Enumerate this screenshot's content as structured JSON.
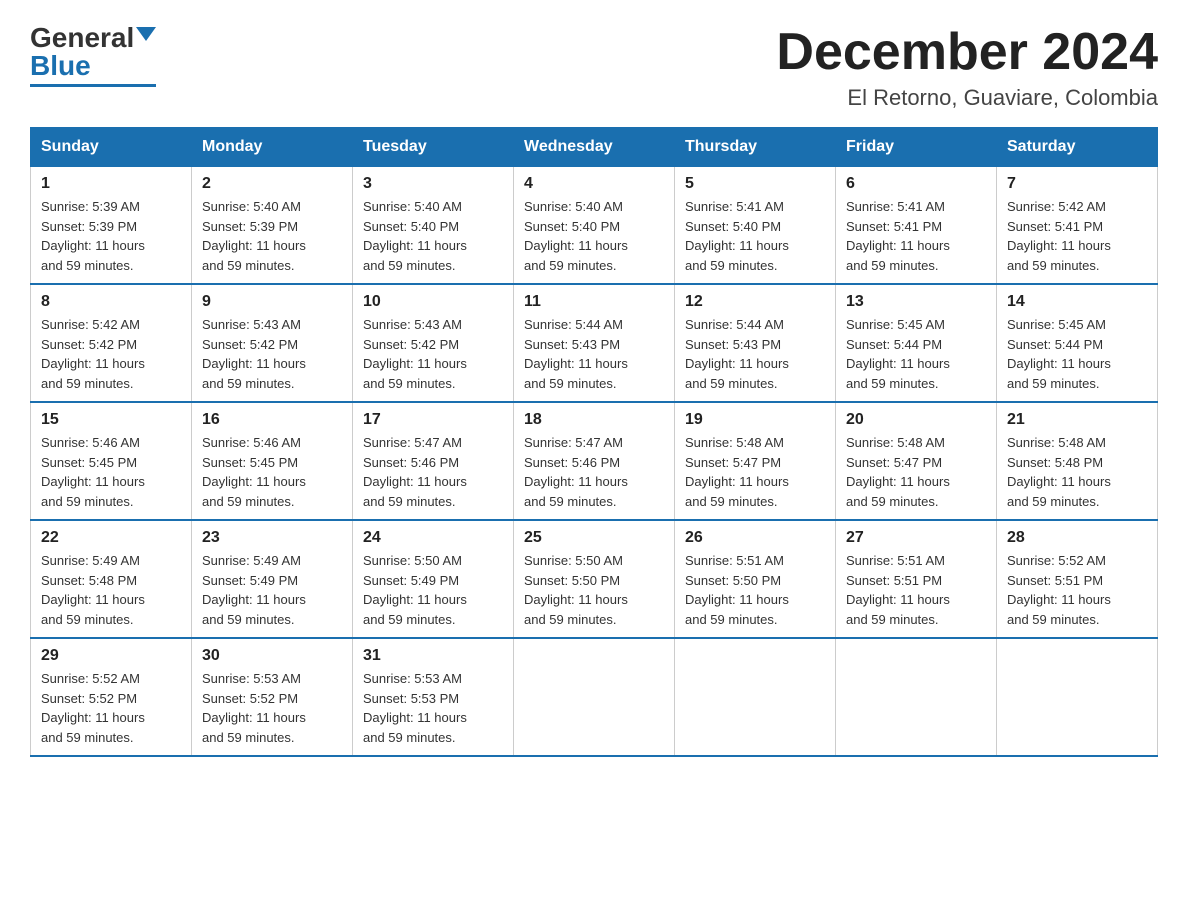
{
  "logo": {
    "general": "General",
    "blue": "Blue"
  },
  "header": {
    "month_title": "December 2024",
    "location": "El Retorno, Guaviare, Colombia"
  },
  "days_of_week": [
    "Sunday",
    "Monday",
    "Tuesday",
    "Wednesday",
    "Thursday",
    "Friday",
    "Saturday"
  ],
  "weeks": [
    [
      {
        "day": "1",
        "sunrise": "5:39 AM",
        "sunset": "5:39 PM",
        "daylight": "11 hours and 59 minutes."
      },
      {
        "day": "2",
        "sunrise": "5:40 AM",
        "sunset": "5:39 PM",
        "daylight": "11 hours and 59 minutes."
      },
      {
        "day": "3",
        "sunrise": "5:40 AM",
        "sunset": "5:40 PM",
        "daylight": "11 hours and 59 minutes."
      },
      {
        "day": "4",
        "sunrise": "5:40 AM",
        "sunset": "5:40 PM",
        "daylight": "11 hours and 59 minutes."
      },
      {
        "day": "5",
        "sunrise": "5:41 AM",
        "sunset": "5:40 PM",
        "daylight": "11 hours and 59 minutes."
      },
      {
        "day": "6",
        "sunrise": "5:41 AM",
        "sunset": "5:41 PM",
        "daylight": "11 hours and 59 minutes."
      },
      {
        "day": "7",
        "sunrise": "5:42 AM",
        "sunset": "5:41 PM",
        "daylight": "11 hours and 59 minutes."
      }
    ],
    [
      {
        "day": "8",
        "sunrise": "5:42 AM",
        "sunset": "5:42 PM",
        "daylight": "11 hours and 59 minutes."
      },
      {
        "day": "9",
        "sunrise": "5:43 AM",
        "sunset": "5:42 PM",
        "daylight": "11 hours and 59 minutes."
      },
      {
        "day": "10",
        "sunrise": "5:43 AM",
        "sunset": "5:42 PM",
        "daylight": "11 hours and 59 minutes."
      },
      {
        "day": "11",
        "sunrise": "5:44 AM",
        "sunset": "5:43 PM",
        "daylight": "11 hours and 59 minutes."
      },
      {
        "day": "12",
        "sunrise": "5:44 AM",
        "sunset": "5:43 PM",
        "daylight": "11 hours and 59 minutes."
      },
      {
        "day": "13",
        "sunrise": "5:45 AM",
        "sunset": "5:44 PM",
        "daylight": "11 hours and 59 minutes."
      },
      {
        "day": "14",
        "sunrise": "5:45 AM",
        "sunset": "5:44 PM",
        "daylight": "11 hours and 59 minutes."
      }
    ],
    [
      {
        "day": "15",
        "sunrise": "5:46 AM",
        "sunset": "5:45 PM",
        "daylight": "11 hours and 59 minutes."
      },
      {
        "day": "16",
        "sunrise": "5:46 AM",
        "sunset": "5:45 PM",
        "daylight": "11 hours and 59 minutes."
      },
      {
        "day": "17",
        "sunrise": "5:47 AM",
        "sunset": "5:46 PM",
        "daylight": "11 hours and 59 minutes."
      },
      {
        "day": "18",
        "sunrise": "5:47 AM",
        "sunset": "5:46 PM",
        "daylight": "11 hours and 59 minutes."
      },
      {
        "day": "19",
        "sunrise": "5:48 AM",
        "sunset": "5:47 PM",
        "daylight": "11 hours and 59 minutes."
      },
      {
        "day": "20",
        "sunrise": "5:48 AM",
        "sunset": "5:47 PM",
        "daylight": "11 hours and 59 minutes."
      },
      {
        "day": "21",
        "sunrise": "5:48 AM",
        "sunset": "5:48 PM",
        "daylight": "11 hours and 59 minutes."
      }
    ],
    [
      {
        "day": "22",
        "sunrise": "5:49 AM",
        "sunset": "5:48 PM",
        "daylight": "11 hours and 59 minutes."
      },
      {
        "day": "23",
        "sunrise": "5:49 AM",
        "sunset": "5:49 PM",
        "daylight": "11 hours and 59 minutes."
      },
      {
        "day": "24",
        "sunrise": "5:50 AM",
        "sunset": "5:49 PM",
        "daylight": "11 hours and 59 minutes."
      },
      {
        "day": "25",
        "sunrise": "5:50 AM",
        "sunset": "5:50 PM",
        "daylight": "11 hours and 59 minutes."
      },
      {
        "day": "26",
        "sunrise": "5:51 AM",
        "sunset": "5:50 PM",
        "daylight": "11 hours and 59 minutes."
      },
      {
        "day": "27",
        "sunrise": "5:51 AM",
        "sunset": "5:51 PM",
        "daylight": "11 hours and 59 minutes."
      },
      {
        "day": "28",
        "sunrise": "5:52 AM",
        "sunset": "5:51 PM",
        "daylight": "11 hours and 59 minutes."
      }
    ],
    [
      {
        "day": "29",
        "sunrise": "5:52 AM",
        "sunset": "5:52 PM",
        "daylight": "11 hours and 59 minutes."
      },
      {
        "day": "30",
        "sunrise": "5:53 AM",
        "sunset": "5:52 PM",
        "daylight": "11 hours and 59 minutes."
      },
      {
        "day": "31",
        "sunrise": "5:53 AM",
        "sunset": "5:53 PM",
        "daylight": "11 hours and 59 minutes."
      },
      null,
      null,
      null,
      null
    ]
  ],
  "labels": {
    "sunrise": "Sunrise:",
    "sunset": "Sunset:",
    "daylight": "Daylight:"
  }
}
